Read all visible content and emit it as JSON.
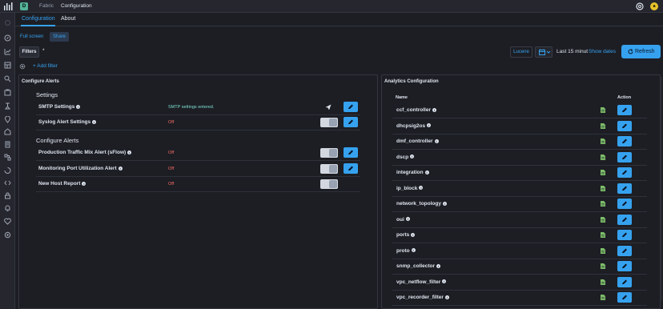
{
  "header": {
    "space_initial": "D",
    "breadcrumbs": [
      "Fabric",
      "Configuration"
    ],
    "avatar_initial": "a"
  },
  "tabs": [
    {
      "label": "Configuration",
      "active": true
    },
    {
      "label": "About",
      "active": false
    }
  ],
  "subtabs": {
    "fullscreen": "Full screen",
    "share": "Share"
  },
  "filterbar": {
    "filters_label": "Filters",
    "query": "*",
    "lucene_label": "Lucene",
    "date_range": "Last 15 minut",
    "show_dates": "Show dates",
    "refresh_label": "Refresh",
    "add_filter": "+ Add filter"
  },
  "alerts": {
    "title": "Configure Alerts",
    "settings_heading": "Settings",
    "configure_heading": "Configure Alerts",
    "settings_rows": [
      {
        "label": "SMTP Settings",
        "status": "SMTP settings entered.",
        "status_kind": "ok",
        "control": "send",
        "editable": true
      },
      {
        "label": "Syslog Alert Settings",
        "status": "Off",
        "status_kind": "off",
        "control": "toggle",
        "editable": true
      }
    ],
    "alert_rows": [
      {
        "label": "Production Traffic Mix Alert (sFlow)",
        "status": "Off",
        "status_kind": "off",
        "control": "toggle",
        "editable": true
      },
      {
        "label": "Monitoring Port Utilization Alert",
        "status": "Off",
        "status_kind": "off",
        "control": "toggle",
        "editable": true
      },
      {
        "label": "New Host Report",
        "status": "Off",
        "status_kind": "off",
        "control": "toggle",
        "editable": false
      }
    ]
  },
  "analytics": {
    "title": "Analytics Configuration",
    "col_name": "Name",
    "col_action": "Action",
    "rows": [
      "ccf_controller",
      "dhcpsig2os",
      "dmf_controller",
      "dscp",
      "integration",
      "ip_block",
      "network_topology",
      "oui",
      "ports",
      "proto",
      "snmp_collector",
      "vpc_netflow_filter",
      "vpc_recorder_filter"
    ]
  },
  "colors": {
    "accent": "#36a2ef",
    "background": "#1d1e24",
    "status_ok": "#7de2d1",
    "status_off": "#f86b63",
    "doc_icon": "#7dbd6a"
  }
}
